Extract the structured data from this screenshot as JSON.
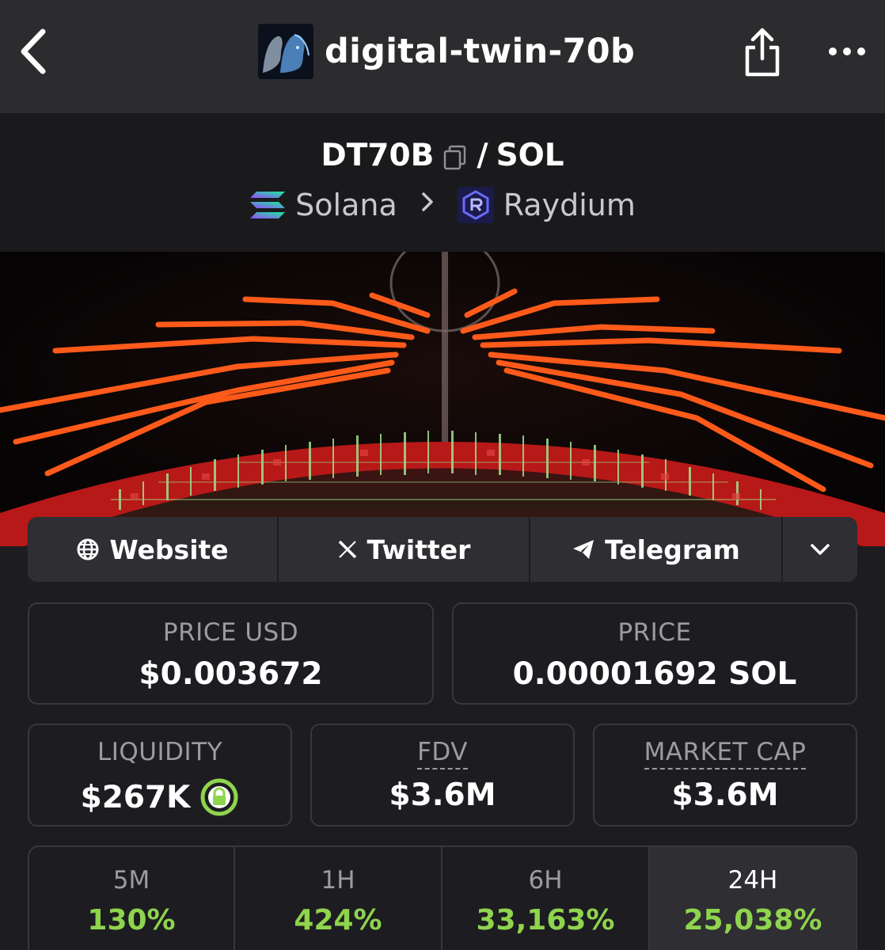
{
  "nav": {
    "title": "digital-twin-70b"
  },
  "pair": {
    "base": "DT70B",
    "separator": "/",
    "quote": "SOL",
    "chain": "Solana",
    "dex": "Raydium"
  },
  "links": {
    "website": "Website",
    "twitter": "Twitter",
    "telegram": "Telegram"
  },
  "stats": {
    "price_usd_label": "PRICE USD",
    "price_usd_value": "$0.003672",
    "price_label": "PRICE",
    "price_value": "0.00001692 SOL",
    "liquidity_label": "LIQUIDITY",
    "liquidity_value": "$267K",
    "fdv_label": "FDV",
    "fdv_value": "$3.6M",
    "mcap_label": "MARKET CAP",
    "mcap_value": "$3.6M"
  },
  "changes": [
    {
      "label": "5M",
      "value": "130%"
    },
    {
      "label": "1H",
      "value": "424%"
    },
    {
      "label": "6H",
      "value": "33,163%"
    },
    {
      "label": "24H",
      "value": "25,038%"
    }
  ],
  "colors": {
    "positive": "#8fd44d",
    "lock": "#8fd44d",
    "background": "#1d1d21"
  }
}
